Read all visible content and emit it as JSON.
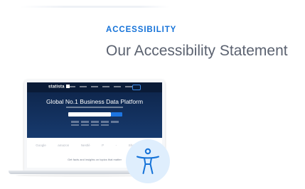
{
  "section": {
    "eyebrow": "ACCESSIBILITY",
    "headline": "Our Accessibility Statement"
  },
  "laptop_screen": {
    "hero_title": "Global No.1 Business Data Platform",
    "logo_text": "statista",
    "brands": [
      "Google",
      "amazon",
      "Nestlé",
      "P",
      "-",
      "Shopee",
      "A"
    ],
    "tagline": "Get facts and insights on topics that matter"
  },
  "icons": {
    "accessibility": "accessibility-person-icon"
  },
  "colors": {
    "accent": "#1472d8",
    "headline": "#5b6270",
    "hero_bg": "#0d2347",
    "badge_bg": "#dfeefd"
  }
}
